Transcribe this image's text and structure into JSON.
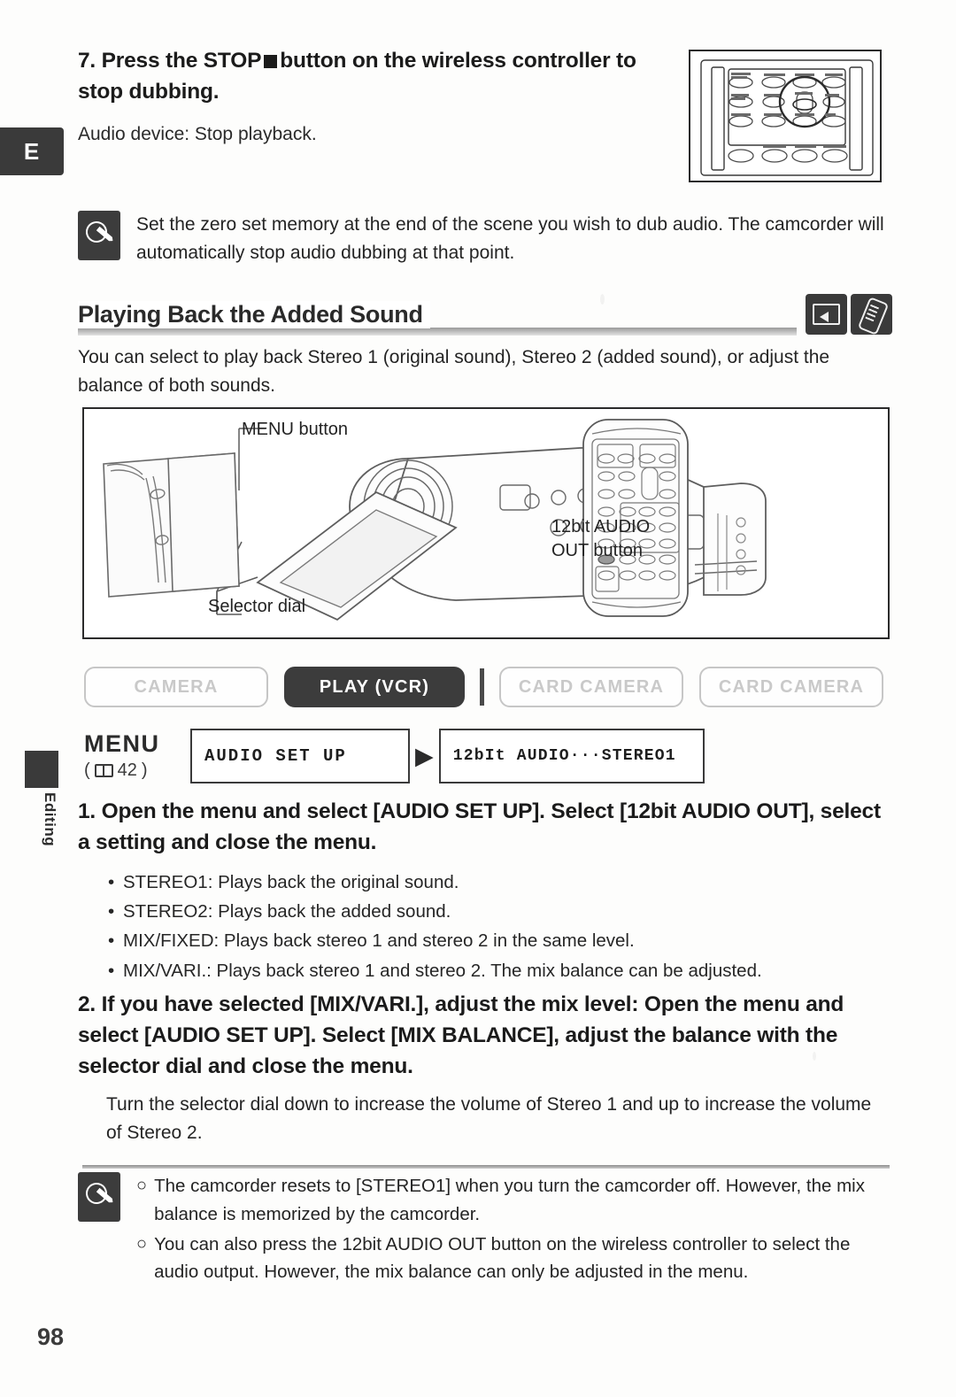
{
  "page": {
    "number": "98",
    "section_tab": "E",
    "side_tab": "Editing"
  },
  "step7": {
    "number": "7.",
    "heading_before": "Press the STOP",
    "heading_after": "button on the wireless controller to stop dubbing.",
    "body": "Audio device: Stop playback."
  },
  "note_top": {
    "icon": "note-pencil-icon",
    "text": "Set the zero set memory at the end of the scene you wish to dub audio. The camcorder will automatically stop audio dubbing at that point."
  },
  "section": {
    "title": "Playing Back the Added Sound",
    "icons": [
      "tape-icon",
      "wireless-controller-icon"
    ],
    "intro": "You can select to play back Stereo 1 (original sound), Stereo 2 (added sound), or adjust the balance of both sounds."
  },
  "illustration": {
    "label_menu_button": "MENU button",
    "label_selector_dial": "Selector dial",
    "label_12bit_line1": "12bit AUDIO",
    "label_12bit_line2": "OUT button"
  },
  "modes": [
    {
      "label": "CAMERA",
      "active": false
    },
    {
      "label": "PLAY (VCR)",
      "active": true
    },
    {
      "label": "CARD CAMERA",
      "active": false
    },
    {
      "label": "CARD CAMERA",
      "active": false
    }
  ],
  "menu_row": {
    "menu_word": "MENU",
    "page_ref": "42",
    "box1": "AUDIO SET UP",
    "arrow": "▶",
    "box2": "12bIt AUDIO···STEREO1"
  },
  "step1": {
    "number": "1.",
    "heading": "Open the menu and select [AUDIO SET UP]. Select [12bit AUDIO OUT], select a setting and close the menu.",
    "bullets": [
      "STEREO1: Plays back the original sound.",
      "STEREO2: Plays back the added sound.",
      "MIX/FIXED: Plays back stereo 1 and stereo 2 in the same level.",
      "MIX/VARI.: Plays back stereo 1 and stereo 2. The mix balance can be adjusted."
    ]
  },
  "step2": {
    "number": "2.",
    "heading": "If you have selected [MIX/VARI.], adjust the mix level: Open the menu and select [AUDIO SET UP]. Select [MIX BALANCE], adjust the balance with the selector dial and close the menu.",
    "body": "Turn the selector dial down to increase the volume of Stereo 1 and up to increase the volume of Stereo 2."
  },
  "notes_bottom": {
    "icon": "note-pencil-icon",
    "marker": "○",
    "items": [
      "The camcorder resets to [STEREO1] when you turn the camcorder off. However, the mix balance is memorized by the camcorder.",
      "You can also press the 12bit AUDIO OUT button on the wireless controller to select the audio output. However, the mix balance can only be adjusted in the menu."
    ]
  },
  "colors": {
    "ink": "#1b1b1b",
    "tab_dark": "#3a3a3a",
    "mode_active_bg": "#3c3c3c",
    "mode_inactive_border": "#c6c6c6"
  }
}
